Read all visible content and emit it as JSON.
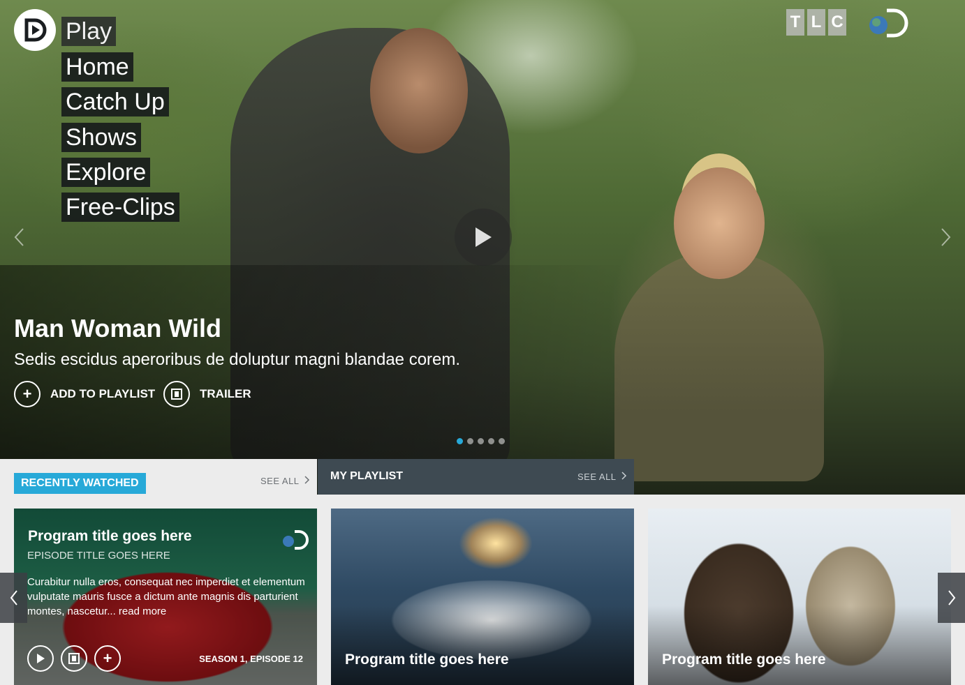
{
  "nav": {
    "play": "Play",
    "items": [
      "Home",
      "Catch Up",
      "Shows",
      "Explore",
      "Free-Clips"
    ]
  },
  "brand": {
    "tlc_letters": [
      "T",
      "L",
      "C"
    ]
  },
  "hero": {
    "title": "Man Woman Wild",
    "description": "Sedis escidus aperoribus de doluptur magni blandae corem.",
    "add_to_playlist": "ADD TO PLAYLIST",
    "trailer": "TRAILER",
    "slide_count": 5,
    "active_slide": 1
  },
  "sections": {
    "recently_watched": {
      "label": "RECENTLY WATCHED",
      "see_all": "SEE ALL"
    },
    "my_playlist": {
      "label": "MY PLAYLIST",
      "see_all": "SEE ALL"
    }
  },
  "cards": [
    {
      "title": "Program title goes here",
      "episode_title": "EPISODE TITLE GOES HERE",
      "description": "Curabitur nulla eros, consequat nec imperdiet et elementum vulputate mauris fusce a dictum ante magnis dis parturient montes, nascetur... read more",
      "meta": "SEASON 1, EPISODE 12"
    },
    {
      "title": "Program title goes here"
    },
    {
      "title": "Program title goes here"
    }
  ],
  "colors": {
    "accent": "#27a9d8",
    "playlist_header": "#3e4a52",
    "nav_bg": "#14181a"
  },
  "icons": [
    "play-icon",
    "plus-icon",
    "film-icon",
    "chevron-left-icon",
    "chevron-right-icon",
    "discovery-logo-icon"
  ]
}
